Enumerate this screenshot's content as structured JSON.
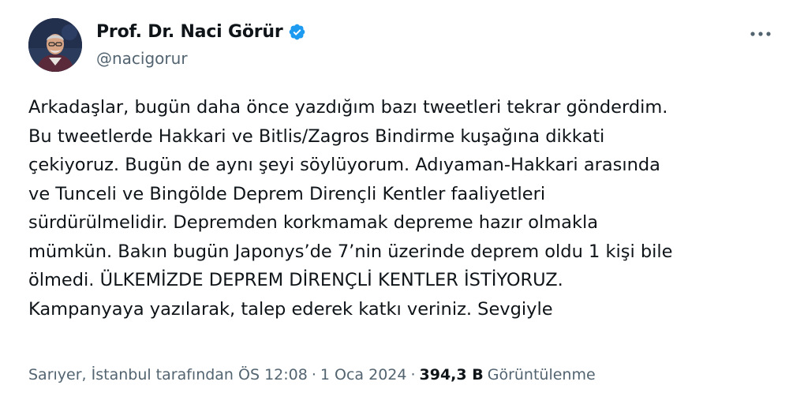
{
  "author": {
    "name": "Prof. Dr. Naci Görür",
    "handle": "@nacigorur",
    "verified": true,
    "verified_color": "#1d9bf0"
  },
  "tweet": {
    "lines": [
      "Arkadaşlar, bugün daha önce yazdığım bazı tweetleri tekrar gönderdim.",
      "Bu tweetlerde Hakkari ve Bitlis/Zagros Bindirme kuşağına dikkati",
      "çekiyoruz. Bugün de aynı şeyi söylüyorum. Adıyaman-Hakkari arasında",
      "ve Tunceli ve Bingölde Deprem Dirençli Kentler faaliyetleri",
      "sürdürülmelidir. Depremden korkmamak depreme hazır olmakla",
      "mümkün. Bakın  bugün Japonys’de 7’nin üzerinde deprem oldu 1 kişi bile",
      "ölmedi. ÜLKEMİZDE DEPREM DİRENÇLİ KENTLER İSTİYORUZ.",
      "Kampanyaya yazılarak, talep ederek katkı veriniz. Sevgiyle"
    ]
  },
  "meta": {
    "location": "Sarıyer, İstanbul tarafından",
    "time": "ÖS 12:08",
    "separator": "·",
    "date": "1 Oca 2024",
    "views_count": "394,3 B",
    "views_label": "Görüntülenme"
  },
  "icons": {
    "verified": "verified-badge-icon",
    "more": "more-dots-icon"
  },
  "colors": {
    "text": "#0f1419",
    "secondary": "#536471",
    "accent": "#1d9bf0"
  }
}
